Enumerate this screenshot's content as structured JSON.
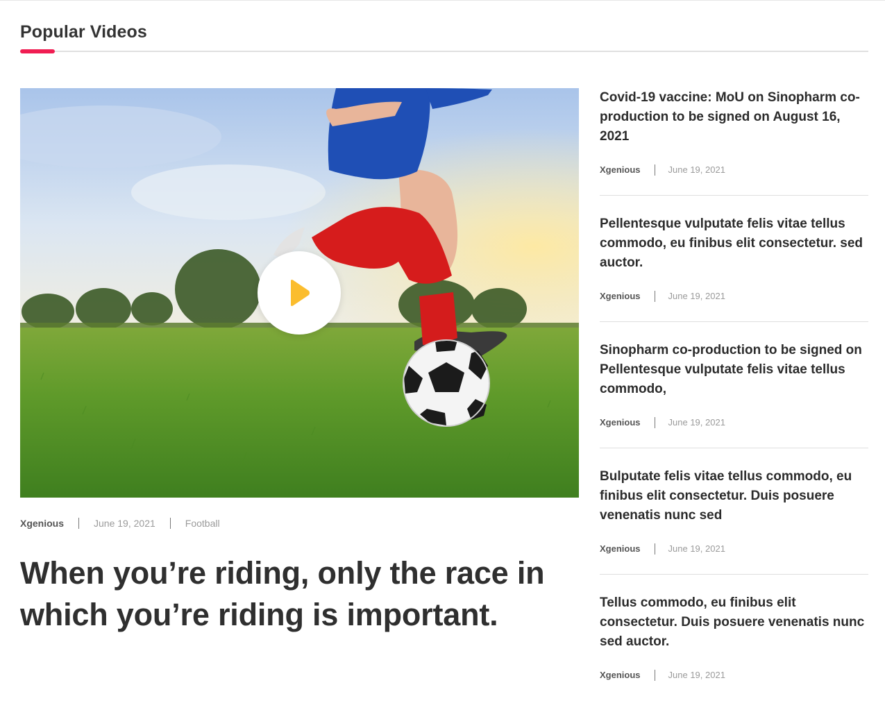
{
  "section": {
    "title": "Popular Videos",
    "accent_color": "#f01d52"
  },
  "feature": {
    "image": "boy-kicking-soccer-ball-on-grass-field",
    "play_icon": "play-icon",
    "play_color": "#fbbd2e",
    "meta": {
      "author": "Xgenious",
      "date": "June 19, 2021",
      "category": "Football"
    },
    "title": "When you’re riding, only the race in which you’re riding is important."
  },
  "side_items": [
    {
      "title": "Covid-19 vaccine: MoU on Sinopharm co-production to be signed on August 16, 2021",
      "author": "Xgenious",
      "date": "June 19, 2021"
    },
    {
      "title": "Pellentesque vulputate felis vitae tellus commodo, eu finibus elit consectetur. sed auctor.",
      "author": "Xgenious",
      "date": "June 19, 2021"
    },
    {
      "title": "Sinopharm co-production to be signed on Pellentesque vulputate felis vitae tellus commodo,",
      "author": "Xgenious",
      "date": "June 19, 2021"
    },
    {
      "title": "Bulputate felis vitae tellus commodo, eu finibus elit consectetur. Duis posuere venenatis nunc sed",
      "author": "Xgenious",
      "date": "June 19, 2021"
    },
    {
      "title": "Tellus commodo, eu finibus elit consectetur. Duis posuere venenatis nunc sed auctor.",
      "author": "Xgenious",
      "date": "June 19, 2021"
    }
  ]
}
